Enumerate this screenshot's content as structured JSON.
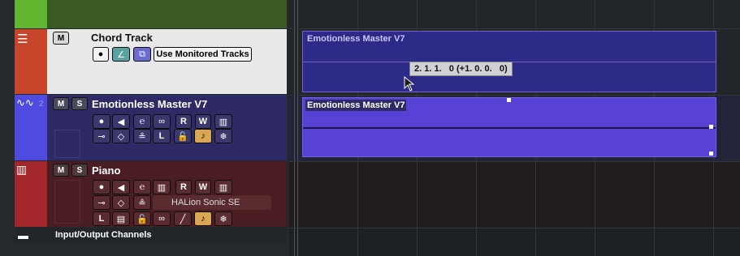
{
  "tracks": [
    {
      "name": "Chord Track",
      "mute": "M",
      "use_monitored": "Use Monitored Tracks"
    },
    {
      "name": "Emotionless Master V7",
      "number": "2",
      "mute": "M",
      "solo": "S",
      "read": "R",
      "write": "W"
    },
    {
      "name": "Piano",
      "mute": "M",
      "solo": "S",
      "read": "R",
      "write": "W",
      "instrument": "HALion Sonic SE"
    }
  ],
  "footer": {
    "label": "Input/Output Channels"
  },
  "events": {
    "chord_part_title": "Emotionless Master V7",
    "audio_part_title": "Emotionless Master V7",
    "tooltip": "2. 1. 1.   0 (+1. 0. 0.   0)"
  },
  "colors": {
    "chord": "#e9e9e9",
    "audio": "#2d2a66",
    "piano": "#4a1d22",
    "part": "#5842d6"
  }
}
